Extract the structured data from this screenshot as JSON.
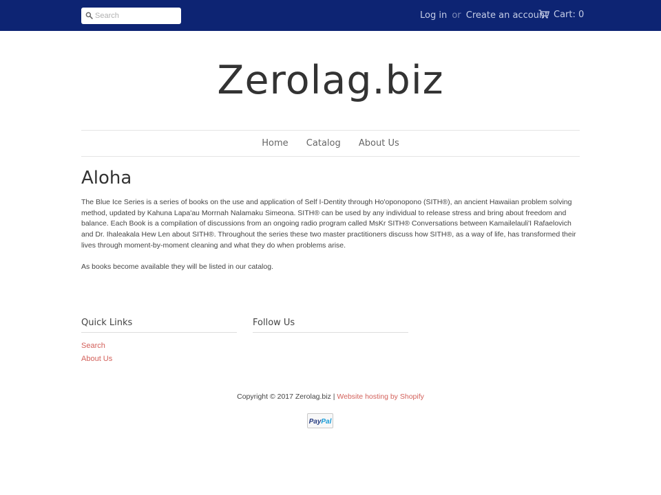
{
  "header": {
    "search": {
      "placeholder": "Search",
      "value": ""
    },
    "login_label": "Log in",
    "or_label": "or",
    "create_account_label": "Create an account",
    "cart_label": "Cart:",
    "cart_count": "0"
  },
  "site": {
    "title": "Zerolag.biz"
  },
  "nav": {
    "items": [
      {
        "label": "Home"
      },
      {
        "label": "Catalog"
      },
      {
        "label": "About Us"
      }
    ]
  },
  "page": {
    "heading": "Aloha",
    "paragraphs": [
      "The Blue Ice Series is a series of books on the use and application of Self I-Dentity through Ho'oponopono (SITH®), an ancient Hawaiian problem solving method, updated by Kahuna Lapa'au Morrnah Nalamaku Simeona. SITH® can be used by any individual to release stress and bring about freedom and balance.  Each Book is a compilation of discussions from an ongoing radio program called MsKr SITH® Conversations between Kamailelauli'I Rafaelovich and Dr. Ihaleakala Hew Len about SITH®. Throughout the series these two master practitioners discuss how SITH®, as a way of life, has transformed their lives through moment-by-moment cleaning and what they do when problems arise.",
      "As books become available they will be listed in our catalog."
    ]
  },
  "footer": {
    "quick_links": {
      "title": "Quick Links",
      "items": [
        {
          "label": "Search"
        },
        {
          "label": "About Us"
        }
      ]
    },
    "follow_us": {
      "title": "Follow Us"
    },
    "copyright": "Copyright © 2017 Zerolag.biz |",
    "hosting_link": "Website hosting by Shopify",
    "payment_badge": "PayPal"
  },
  "icons": {
    "search": "search-icon",
    "cart": "cart-icon",
    "paypal": "paypal-icon"
  },
  "colors": {
    "topbar": "#0d2473",
    "link_accent": "#d3605a",
    "paypal_blue": "#253b80",
    "paypal_light_blue": "#179bd7"
  }
}
